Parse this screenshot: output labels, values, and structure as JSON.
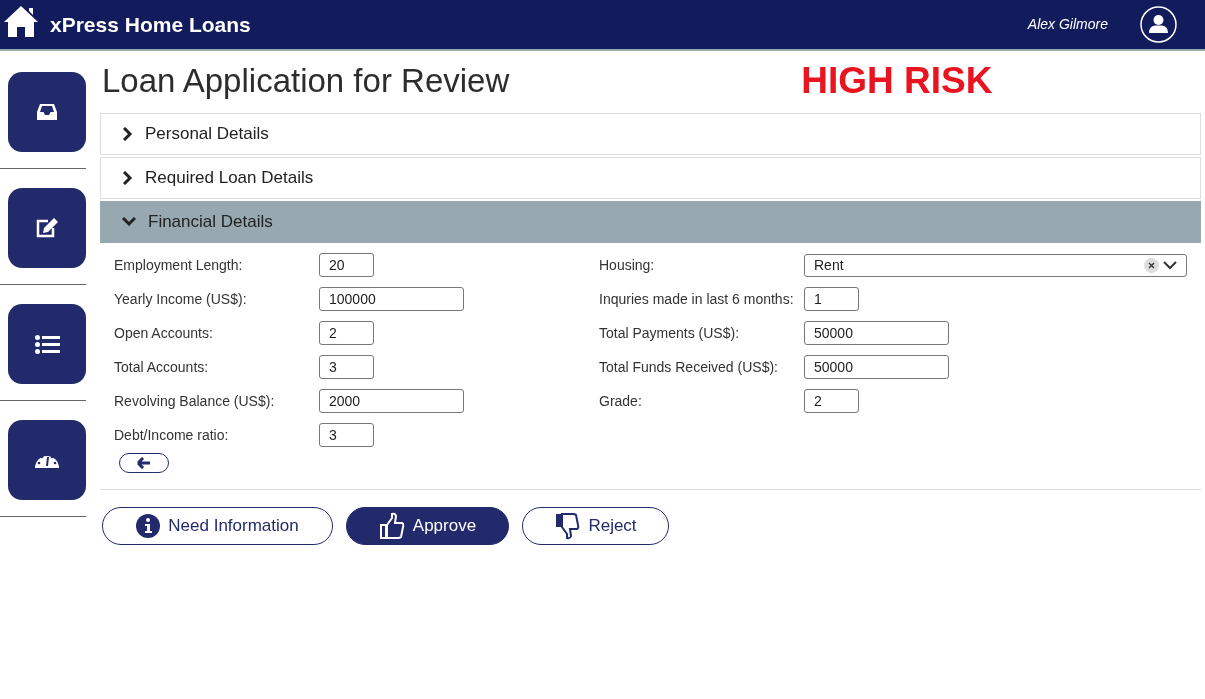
{
  "header": {
    "app_name": "xPress Home Loans",
    "user_name": "Alex Gilmore"
  },
  "page": {
    "title": "Loan Application for Review",
    "risk_label": "HIGH RISK"
  },
  "sections": [
    {
      "title": "Personal Details",
      "expanded": false
    },
    {
      "title": "Required Loan Details",
      "expanded": false
    },
    {
      "title": "Financial Details",
      "expanded": true
    }
  ],
  "fields_left": [
    {
      "label": "Employment Length:",
      "value": "20",
      "kind": "short"
    },
    {
      "label": "Yearly Income (US$):",
      "value": "100000",
      "kind": "wide"
    },
    {
      "label": "Open Accounts:",
      "value": "2",
      "kind": "short"
    },
    {
      "label": "Total Accounts:",
      "value": "3",
      "kind": "short"
    },
    {
      "label": "Revolving Balance (US$):",
      "value": "2000",
      "kind": "wide"
    },
    {
      "label": "Debt/Income ratio:",
      "value": "3",
      "kind": "short"
    }
  ],
  "fields_right": [
    {
      "label": "Housing:",
      "value": "Rent",
      "kind": "select"
    },
    {
      "label": "Inquries made in last 6 months:",
      "value": "1",
      "kind": "short"
    },
    {
      "label": "Total Payments (US$):",
      "value": "50000",
      "kind": "wide"
    },
    {
      "label": "Total Funds Received (US$):",
      "value": "50000",
      "kind": "wide"
    },
    {
      "label": "Grade:",
      "value": "2",
      "kind": "short"
    }
  ],
  "actions": [
    {
      "label": "Need Information",
      "kind": "info"
    },
    {
      "label": "Approve",
      "kind": "approve"
    },
    {
      "label": "Reject",
      "kind": "reject"
    }
  ]
}
